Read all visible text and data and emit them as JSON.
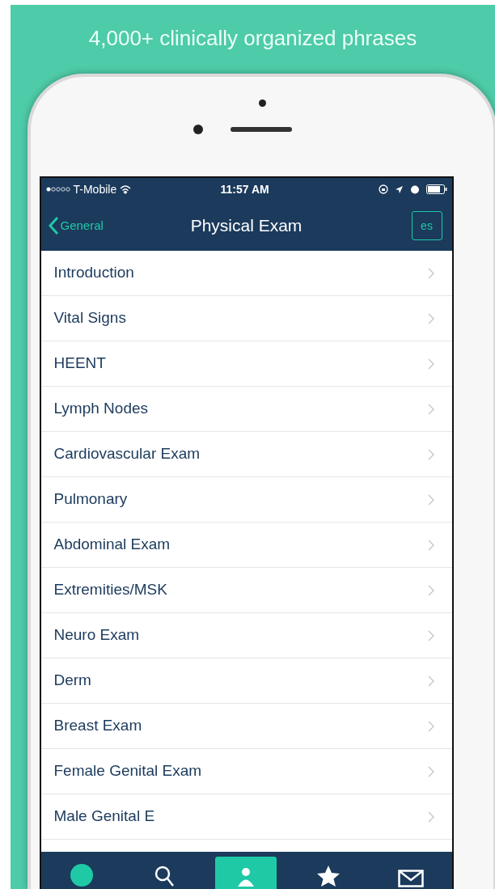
{
  "headline": "4,000+ clinically organized phrases",
  "status_bar": {
    "carrier": "T-Mobile",
    "time": "11:57 AM"
  },
  "nav": {
    "back": "General",
    "title": "Physical Exam",
    "language": "es"
  },
  "items": [
    {
      "label": "Introduction"
    },
    {
      "label": "Vital Signs"
    },
    {
      "label": "HEENT"
    },
    {
      "label": "Lymph Nodes"
    },
    {
      "label": "Cardiovascular Exam"
    },
    {
      "label": "Pulmonary"
    },
    {
      "label": "Abdominal Exam"
    },
    {
      "label": "Extremities/MSK"
    },
    {
      "label": "Neuro Exam"
    },
    {
      "label": "Derm"
    },
    {
      "label": "Breast Exam"
    },
    {
      "label": "Female Genital Exam"
    },
    {
      "label": "Male Genital E"
    }
  ],
  "tabs": [
    {
      "kind": "dot",
      "selected": false
    },
    {
      "kind": "search",
      "selected": false
    },
    {
      "kind": "person",
      "selected": true
    },
    {
      "kind": "star",
      "selected": false
    },
    {
      "kind": "mail",
      "selected": false
    }
  ]
}
